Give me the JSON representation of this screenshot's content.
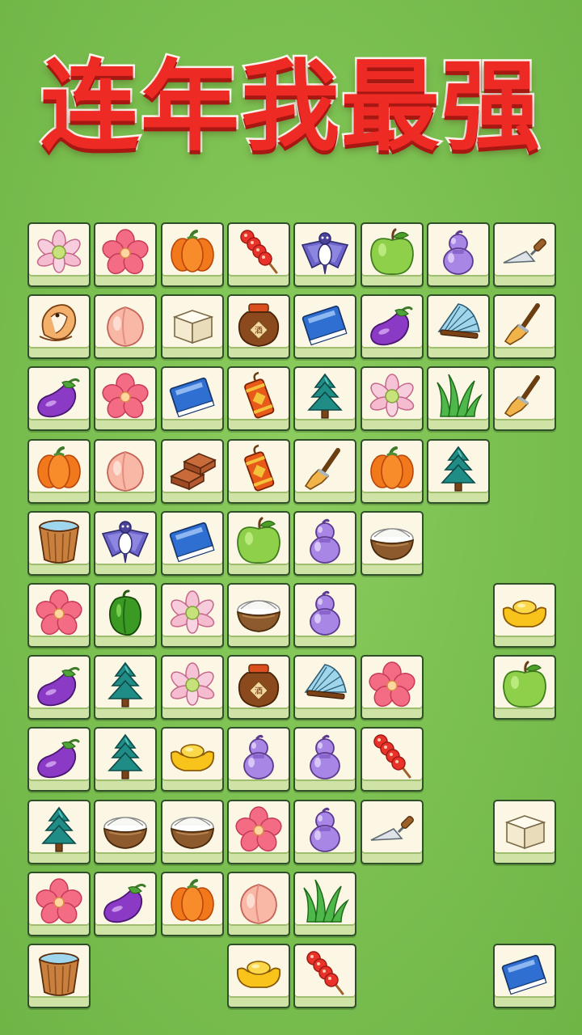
{
  "title": "连年我最强",
  "board": {
    "rows": [
      [
        "lotus",
        "flower",
        "pumpkin",
        "candied-haws",
        "kite",
        "apple",
        "gourd",
        "trowel"
      ],
      [
        "bird",
        "peach",
        "tofu",
        "wine-jar",
        "book",
        "eggplant",
        "fan",
        "brush"
      ],
      [
        "eggplant",
        "flower",
        "book",
        "firecracker",
        "tree",
        "lotus",
        "grass",
        "brush"
      ],
      [
        "pumpkin",
        "peach",
        "bricks",
        "firecracker",
        "brush",
        "pumpkin",
        "tree",
        null
      ],
      [
        "bucket",
        "kite",
        "book",
        "apple",
        "gourd",
        "rice-bowl",
        null,
        null
      ],
      [
        "flower",
        "pepper",
        "lotus",
        "rice-bowl",
        "gourd",
        null,
        null,
        "gold-ingot"
      ],
      [
        "eggplant",
        "tree",
        "lotus",
        "wine-jar",
        "fan",
        "flower",
        null,
        "apple"
      ],
      [
        "eggplant",
        "tree",
        "gold-ingot",
        "gourd",
        "gourd",
        "candied-haws",
        null,
        null
      ],
      [
        "tree",
        "rice-bowl",
        "rice-bowl",
        "flower",
        "gourd",
        "trowel",
        null,
        "tofu"
      ],
      [
        "flower",
        "eggplant",
        "pumpkin",
        "peach",
        "grass",
        null,
        null,
        null
      ],
      [
        "bucket",
        null,
        null,
        "gold-ingot",
        "candied-haws",
        null,
        null,
        "book"
      ]
    ]
  }
}
